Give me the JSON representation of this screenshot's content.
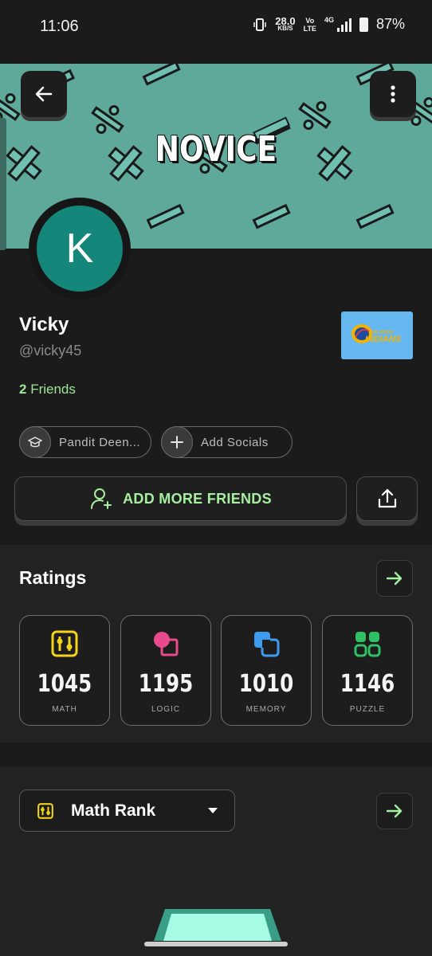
{
  "status_bar": {
    "time": "11:06",
    "speed_value": "28.0",
    "speed_unit": "KB/S",
    "volte_top": "Vo",
    "volte_bottom": "LTE",
    "network": "4G",
    "battery": "87%"
  },
  "banner": {
    "title": "NOVICE",
    "color": "#5fa99a"
  },
  "profile": {
    "avatar_initial": "K",
    "avatar_color": "#14877a",
    "name": "Vicky",
    "handle": "@vicky45",
    "friends_count": "2",
    "friends_label": "Friends",
    "team_logo_line1": "MUMBAI",
    "team_logo_line2": "INDIANS"
  },
  "chips": {
    "school": "Pandit Deen...",
    "socials": "Add Socials"
  },
  "actions": {
    "add_friends": "ADD MORE FRIENDS"
  },
  "ratings": {
    "title": "Ratings",
    "items": [
      {
        "value": "1045",
        "label": "MATH",
        "icon": "math-icon",
        "color": "#f3d31c"
      },
      {
        "value": "1195",
        "label": "LOGIC",
        "icon": "logic-icon",
        "color": "#e84a8c"
      },
      {
        "value": "1010",
        "label": "MEMORY",
        "icon": "memory-icon",
        "color": "#3d9cf0"
      },
      {
        "value": "1146",
        "label": "PUZZLE",
        "icon": "puzzle-icon",
        "color": "#2fbf64"
      }
    ]
  },
  "rank": {
    "selected": "Math Rank"
  },
  "colors": {
    "accent_green": "#a6ef9f",
    "background": "#1b1b1b"
  }
}
